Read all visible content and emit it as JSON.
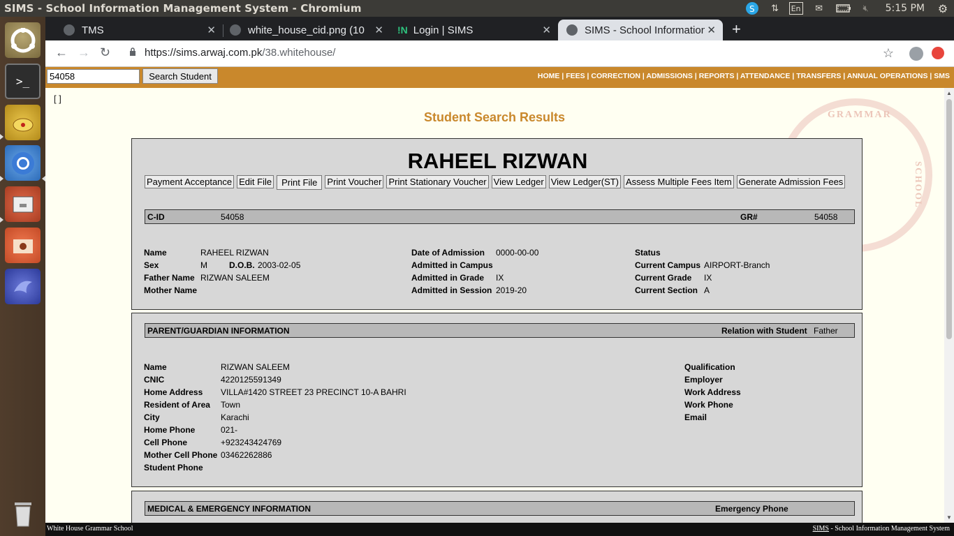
{
  "top_panel": {
    "title": "SIMS - School Information Management System - Chromium",
    "lang": "En",
    "time": "5:15 PM"
  },
  "tabs": [
    {
      "label": "TMS"
    },
    {
      "label": "white_house_cid.png (10"
    },
    {
      "label": "Login | SIMS"
    },
    {
      "label": "SIMS - School Information"
    }
  ],
  "address": {
    "host": "https://sims.arwaj.com.pk",
    "path": "/38.whitehouse/"
  },
  "search": {
    "value": "54058",
    "button": "Search Student"
  },
  "menu": [
    "HOME",
    "FEES",
    "CORRECTION",
    "ADMISSIONS",
    "REPORTS",
    "ATTENDANCE",
    "TRANSFERS",
    "ANNUAL OPERATIONS",
    "SMS"
  ],
  "bracket": "[ ]",
  "heading": "Student Search Results",
  "watermark": {
    "top": "GRAMMAR",
    "side": "SCHOOL"
  },
  "student": {
    "name": "RAHEEL RIZWAN",
    "actions": [
      "Payment Acceptance",
      "Edit File",
      "Print File",
      "Print Voucher",
      "Print Stationary Voucher",
      "View Ledger",
      "View Ledger(ST)",
      "Assess Multiple Fees Item",
      "Generate Admission Fees"
    ],
    "cid_label": "C-ID",
    "cid": "54058",
    "gr_label": "GR#",
    "gr": "54058",
    "fields": {
      "name_l": "Name",
      "name": "RAHEEL RIZWAN",
      "sex_l": "Sex",
      "sex": "M",
      "dob_l": "D.O.B.",
      "dob": "2003-02-05",
      "father_l": "Father Name",
      "father": "RIZWAN SALEEM",
      "mother_l": "Mother Name",
      "doa_l": "Date of Admission",
      "doa": "0000-00-00",
      "campus_l": "Admitted in Campus",
      "grade_l": "Admitted in Grade",
      "grade": "IX",
      "session_l": "Admitted in Session",
      "session": "2019-20",
      "status_l": "Status",
      "ccampus_l": "Current Campus",
      "ccampus": "AIRPORT-Branch",
      "cgrade_l": "Current Grade",
      "cgrade": "IX",
      "csection_l": "Current Section",
      "csection": "A"
    }
  },
  "guardian": {
    "title": "PARENT/GUARDIAN INFORMATION",
    "relation_l": "Relation with Student",
    "relation": "Father",
    "name_l": "Name",
    "name": "RIZWAN SALEEM",
    "cnic_l": "CNIC",
    "cnic": "4220125591349",
    "addr_l": "Home Address",
    "addr": "VILLA#1420 STREET 23 PRECINCT 10-A BAHRI",
    "area_l": "Resident of Area",
    "area": "Town",
    "city_l": "City",
    "city": "Karachi",
    "hphone_l": "Home Phone",
    "hphone": "021-",
    "cell_l": "Cell Phone",
    "cell": "+923243424769",
    "mcell_l": "Mother Cell Phone",
    "mcell": "03462262886",
    "sphone_l": "Student Phone",
    "qual_l": "Qualification",
    "emp_l": "Employer",
    "waddr_l": "Work Address",
    "wphone_l": "Work Phone",
    "email_l": "Email"
  },
  "medical": {
    "title": "MEDICAL & EMERGENCY INFORMATION",
    "emergency_l": "Emergency Phone"
  },
  "footer": {
    "left": "White House Grammar School",
    "right_link": "SIMS",
    "right_rest": " - School Information Management System"
  }
}
